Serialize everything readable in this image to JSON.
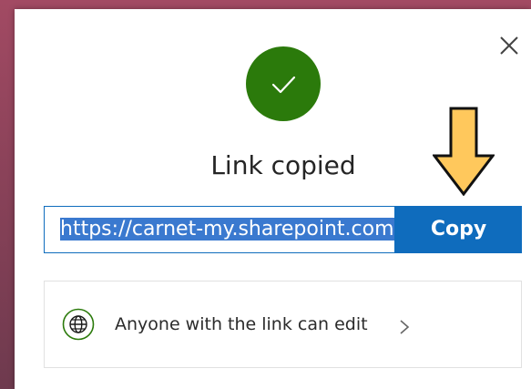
{
  "dialog": {
    "title": "Link copied",
    "link": {
      "value": "https://carnet-my.sharepoint.com",
      "selected": true
    },
    "copy_label": "Copy",
    "permission": {
      "label": "Anyone with the link can edit"
    },
    "icons": {
      "close": "close-icon",
      "success": "checkmark-icon",
      "annotation": "down-arrow-annotation",
      "permission": "globe-icon",
      "chevron": "chevron-right-icon"
    },
    "colors": {
      "accent": "#0f6cbd",
      "success": "#2b7a0b",
      "arrow_fill": "#ffc85c",
      "background": "#8a4259"
    }
  }
}
